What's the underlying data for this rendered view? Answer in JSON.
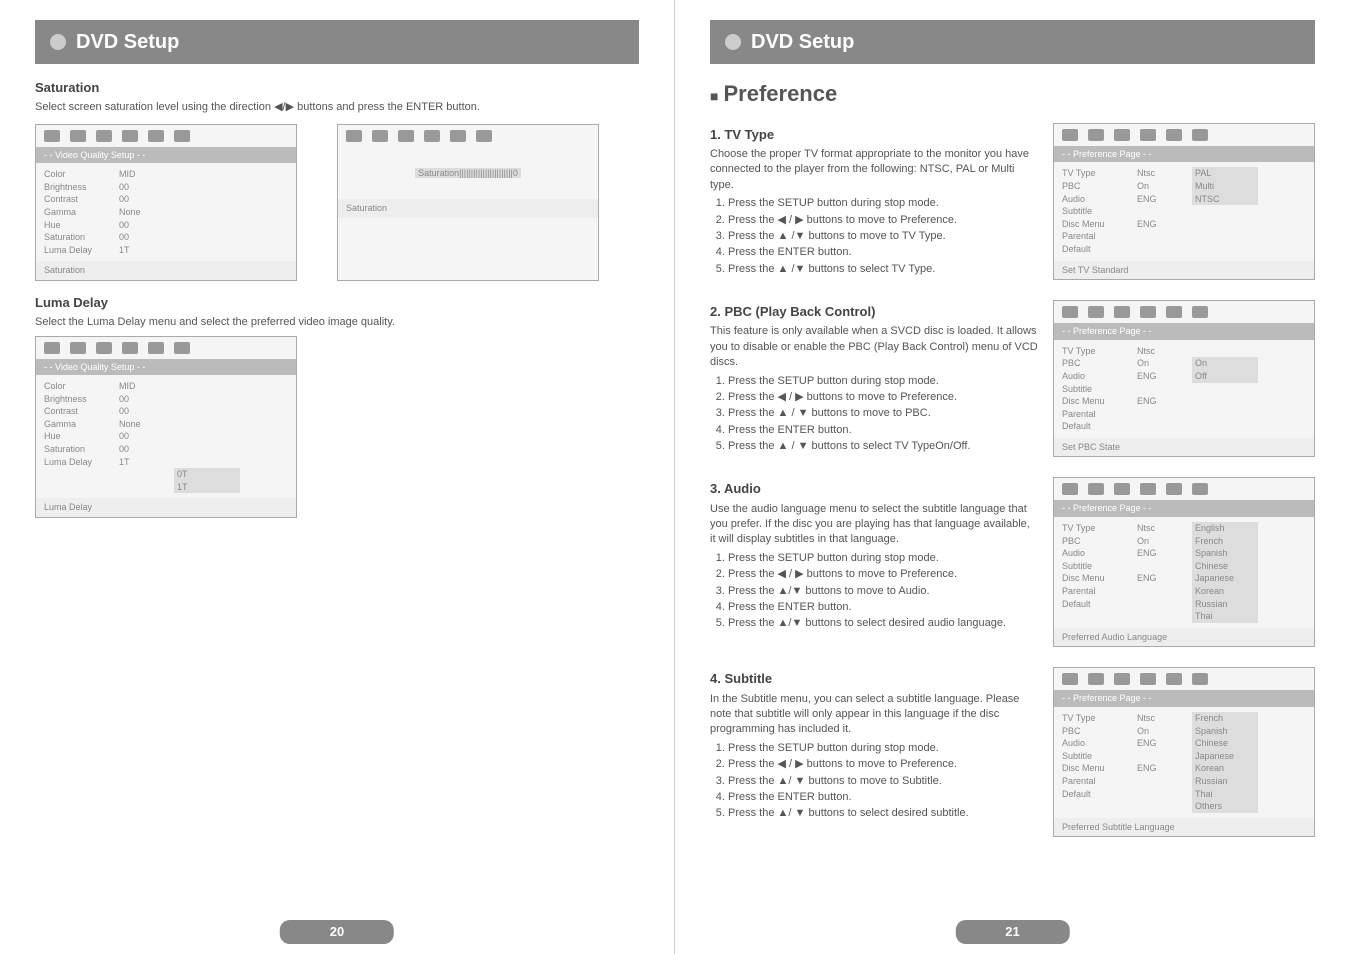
{
  "left": {
    "header": "DVD Setup",
    "saturation": {
      "title": "Saturation",
      "desc": "Select screen saturation level using the direction ◀/▶ buttons and press the ENTER button.",
      "osd1_title": "- - Video Quality Setup - -",
      "osd1_rows": [
        {
          "c1": "Color",
          "c2": "MID"
        },
        {
          "c1": "Brightness",
          "c2": "00"
        },
        {
          "c1": "Contrast",
          "c2": "00"
        },
        {
          "c1": "Gamma",
          "c2": "None"
        },
        {
          "c1": "Hue",
          "c2": "00"
        },
        {
          "c1": "Saturation",
          "c2": "00"
        },
        {
          "c1": "Luma Delay",
          "c2": "1T"
        }
      ],
      "osd1_foot": "Saturation",
      "osd2_center": "Saturation|||||||||||||||||||||||0",
      "osd2_foot": "Saturation"
    },
    "luma": {
      "title": "Luma Delay",
      "desc": "Select the Luma Delay menu and select the preferred video image quality.",
      "osd_title": "- - Video Quality Setup - -",
      "osd_rows": [
        {
          "c1": "Color",
          "c2": "MID"
        },
        {
          "c1": "Brightness",
          "c2": "00"
        },
        {
          "c1": "Contrast",
          "c2": "00"
        },
        {
          "c1": "Gamma",
          "c2": "None"
        },
        {
          "c1": "Hue",
          "c2": "00"
        },
        {
          "c1": "Saturation",
          "c2": "00"
        },
        {
          "c1": "Luma Delay",
          "c2": "1T",
          "sub": [
            "0T",
            "1T"
          ]
        }
      ],
      "osd_foot": "Luma Delay"
    },
    "page": "20"
  },
  "right": {
    "header": "DVD Setup",
    "preference": "Preference",
    "tv": {
      "title": "1. TV Type",
      "desc": "Choose the proper TV format appropriate to the monitor you have connected to the player from the following: NTSC, PAL or Multi type.",
      "steps": [
        "Press the SETUP button during stop mode.",
        "Press the ◀ / ▶ buttons to move to Preference.",
        "Press the ▲ /▼ buttons to move to TV Type.",
        "Press the ENTER button.",
        "Press the ▲ /▼ buttons to select TV Type."
      ],
      "osd_title": "- - Preference Page - -",
      "osd_rows": [
        {
          "c1": "TV Type",
          "c2": "Ntsc",
          "c3": "PAL"
        },
        {
          "c1": "PBC",
          "c2": "On",
          "c3": "Multi"
        },
        {
          "c1": "Audio",
          "c2": "ENG",
          "c3": "NTSC"
        },
        {
          "c1": "Subtitle",
          "c2": ""
        },
        {
          "c1": "Disc Menu",
          "c2": "ENG"
        },
        {
          "c1": "Parental",
          "c2": ""
        },
        {
          "c1": "Default",
          "c2": ""
        }
      ],
      "osd_foot": "Set TV Standard"
    },
    "pbc": {
      "title": "2. PBC (Play Back Control)",
      "desc": "This feature is only available when a SVCD disc is loaded. It allows you to disable or enable the PBC (Play Back Control) menu of VCD discs.",
      "steps": [
        "Press the SETUP button during stop mode.",
        "Press the ◀ / ▶ buttons to move to Preference.",
        "Press the ▲ / ▼ buttons to move to PBC.",
        "Press the ENTER button.",
        "Press the ▲ / ▼ buttons to select TV TypeOn/Off."
      ],
      "osd_title": "- - Preference Page - -",
      "osd_rows": [
        {
          "c1": "TV Type",
          "c2": "Ntsc"
        },
        {
          "c1": "PBC",
          "c2": "On",
          "c3": "On"
        },
        {
          "c1": "Audio",
          "c2": "ENG",
          "c3": "Off"
        },
        {
          "c1": "Subtitle",
          "c2": ""
        },
        {
          "c1": "Disc Menu",
          "c2": "ENG"
        },
        {
          "c1": "Parental",
          "c2": ""
        },
        {
          "c1": "Default",
          "c2": ""
        }
      ],
      "osd_foot": "Set PBC State"
    },
    "audio": {
      "title": "3. Audio",
      "desc": "Use the audio language menu to select the subtitle language that you prefer. If the disc you are playing has that language available, it will display subtitles in that language.",
      "steps": [
        "Press the SETUP button during stop mode.",
        "Press the ◀ / ▶ buttons to move to Preference.",
        "Press the ▲/▼ buttons to move to Audio.",
        "Press the ENTER button.",
        "Press the ▲/▼ buttons to select desired audio language."
      ],
      "osd_title": "- - Preference Page - -",
      "osd_rows": [
        {
          "c1": "TV Type",
          "c2": "Ntsc",
          "c3": "English"
        },
        {
          "c1": "PBC",
          "c2": "On",
          "c3": "French"
        },
        {
          "c1": "Audio",
          "c2": "ENG",
          "c3": "Spanish"
        },
        {
          "c1": "Subtitle",
          "c2": "",
          "c3": "Chinese"
        },
        {
          "c1": "Disc Menu",
          "c2": "ENG",
          "c3": "Japanese"
        },
        {
          "c1": "Parental",
          "c2": "",
          "c3": "Korean"
        },
        {
          "c1": "Default",
          "c2": "",
          "c3": "Russian"
        },
        {
          "c1": "",
          "c2": "",
          "c3": "Thai"
        }
      ],
      "osd_foot": "Preferred Audio Language"
    },
    "subtitle": {
      "title": "4. Subtitle",
      "desc": "In the Subtitle menu, you can select a subtitle language. Please note that subtitle will only appear in this language if the disc programming has included it.",
      "steps": [
        "Press the SETUP button during stop mode.",
        "Press the ◀ / ▶ buttons to move to Preference.",
        "Press the ▲/ ▼ buttons to move to Subtitle.",
        "Press the ENTER button.",
        "Press the ▲/ ▼ buttons to select desired subtitle."
      ],
      "osd_title": "- - Preference Page - -",
      "osd_rows": [
        {
          "c1": "TV Type",
          "c2": "Ntsc",
          "c3": "French"
        },
        {
          "c1": "PBC",
          "c2": "On",
          "c3": "Spanish"
        },
        {
          "c1": "Audio",
          "c2": "ENG",
          "c3": "Chinese"
        },
        {
          "c1": "Subtitle",
          "c2": "",
          "c3": "Japanese"
        },
        {
          "c1": "Disc Menu",
          "c2": "ENG",
          "c3": "Korean"
        },
        {
          "c1": "Parental",
          "c2": "",
          "c3": "Russian"
        },
        {
          "c1": "Default",
          "c2": "",
          "c3": "Thai"
        },
        {
          "c1": "",
          "c2": "",
          "c3": "Others"
        }
      ],
      "osd_foot": "Preferred Subtitle Language"
    },
    "page": "21"
  }
}
